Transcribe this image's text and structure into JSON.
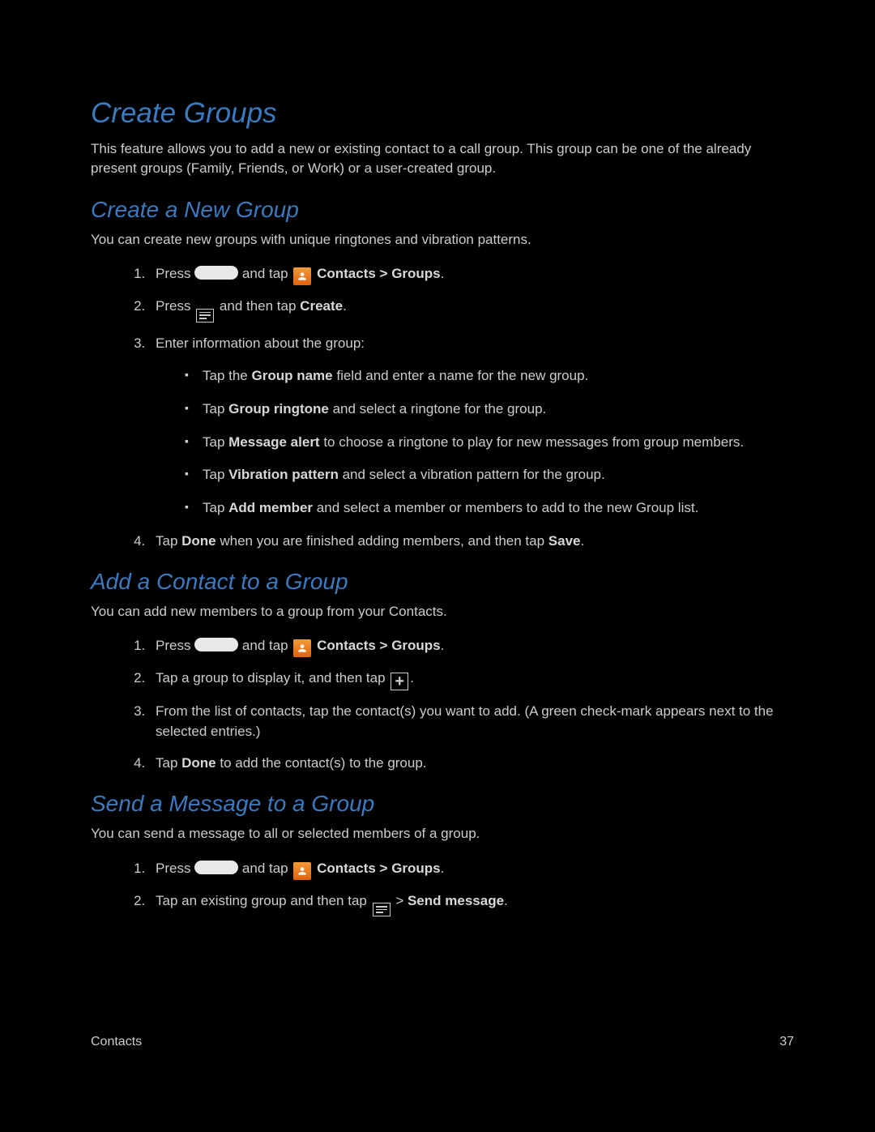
{
  "h1": "Create Groups",
  "intro": "This feature allows you to add a new or existing contact to a call group. This group can be one of the already present groups (Family, Friends, or Work) or a user-created group.",
  "sec1": {
    "title": "Create a New Group",
    "intro": "You can create new groups with unique ringtones and vibration patterns.",
    "step1_a": "Press ",
    "step1_b": " and tap ",
    "step1_c": " Contacts > Groups",
    "step1_d": ".",
    "step2_a": "Press ",
    "step2_b": " and then tap ",
    "step2_c": "Create",
    "step2_d": ".",
    "step3": "Enter information about the group:",
    "b1_a": "Tap the ",
    "b1_b": "Group name",
    "b1_c": " field and enter a name for the new group.",
    "b2_a": "Tap ",
    "b2_b": "Group ringtone",
    "b2_c": " and select a ringtone for the group.",
    "b3_a": "Tap ",
    "b3_b": "Message alert",
    "b3_c": " to choose a ringtone to play for new messages from group members.",
    "b4_a": "Tap ",
    "b4_b": "Vibration pattern",
    "b4_c": " and select a vibration pattern for the group.",
    "b5_a": "Tap ",
    "b5_b": "Add member",
    "b5_c": " and select a member or members to add to the new Group list.",
    "step4_a": "Tap ",
    "step4_b": "Done",
    "step4_c": " when you are finished adding members, and then tap ",
    "step4_d": "Save",
    "step4_e": "."
  },
  "sec2": {
    "title": "Add a Contact to a Group",
    "intro": "You can add new members to a group from your Contacts.",
    "step1_a": "Press ",
    "step1_b": " and tap ",
    "step1_c": " Contacts > Groups",
    "step1_d": ".",
    "step2_a": "Tap a group to display it, and then tap ",
    "step2_b": ".",
    "step3": "From the list of contacts, tap the contact(s) you want to add. (A green check-mark appears next to the selected entries.)",
    "step4_a": "Tap ",
    "step4_b": "Done",
    "step4_c": " to add the contact(s) to the group."
  },
  "sec3": {
    "title": "Send a Message to a Group",
    "intro": "You can send a message to all or selected members of a group.",
    "step1_a": "Press ",
    "step1_b": " and tap ",
    "step1_c": " Contacts > Groups",
    "step1_d": ".",
    "step2_a": "Tap an existing group and then tap ",
    "step2_b": " > ",
    "step2_c": "Send message",
    "step2_d": "."
  },
  "footer": {
    "left": "Contacts",
    "right": "37"
  }
}
